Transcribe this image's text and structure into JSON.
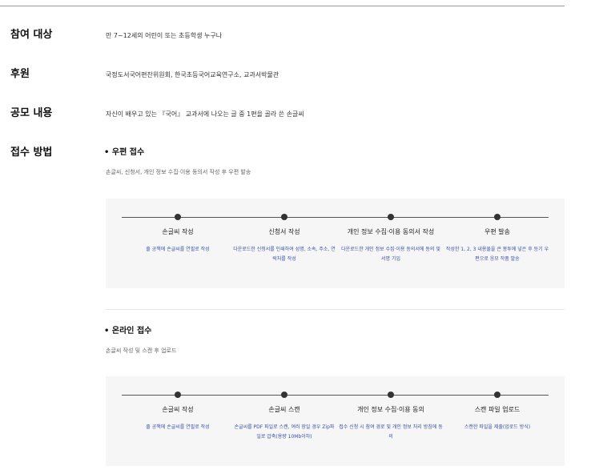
{
  "sections": {
    "target": {
      "label": "참여 대상",
      "text": "만 7~12세의 어린이 또는 초등학생 누구나"
    },
    "sponsor": {
      "label": "후원",
      "text": "국정도서국어편찬위원회, 한국초등국어교육연구소, 교과서박물관"
    },
    "content": {
      "label": "공모 내용",
      "text": "자신이 배우고 있는 『국어』 교과서에 나오는 글 중 1편을 골라 쓴 손글씨"
    },
    "method": {
      "label": "접수 방법"
    }
  },
  "mail": {
    "title": "• 우편 접수",
    "desc": "손글씨, 신청서, 개인 정보 수집·이용 동의서 작성 후 우편 발송",
    "steps": [
      {
        "title": "손글씨 작성",
        "desc": "줄 공책에 손글씨를 연필로 작성"
      },
      {
        "title": "신청서 작성",
        "desc": "다운로드한 신청서를 인쇄하여 성명, 소속, 주소, 연락처를 작성"
      },
      {
        "title": "개인 정보 수집·이용 동의서 작성",
        "desc": "다운로드한 개인 정보 수집·이용 동의서에 동의 및 서명 기입"
      },
      {
        "title": "우편 발송",
        "desc": "작성한 1, 2, 3 내용물을 큰 봉투에 넣은 후 등기 우편으로 응모 작품 발송"
      }
    ]
  },
  "online": {
    "title": "• 온라인 접수",
    "desc": "손글씨 작성 및 스캔 후 업로드",
    "steps": [
      {
        "title": "손글씨 작성",
        "desc": "줄 공책에 손글씨를 연필로 작성"
      },
      {
        "title": "손글씨 스캔",
        "desc": "손글씨를 PDF 파일로 스캔, 여러 장일 경우 Zip파일로 압축(용량 10Mb이하)"
      },
      {
        "title": "개인 정보 수집·이용 동의",
        "desc": "접수 신청 시 참여 경로 및 개인 정보 처리 방침에 동의"
      },
      {
        "title": "스캔 파일 업로드",
        "desc": "스캔한 파일을 제출(업로드 방식)"
      }
    ]
  }
}
